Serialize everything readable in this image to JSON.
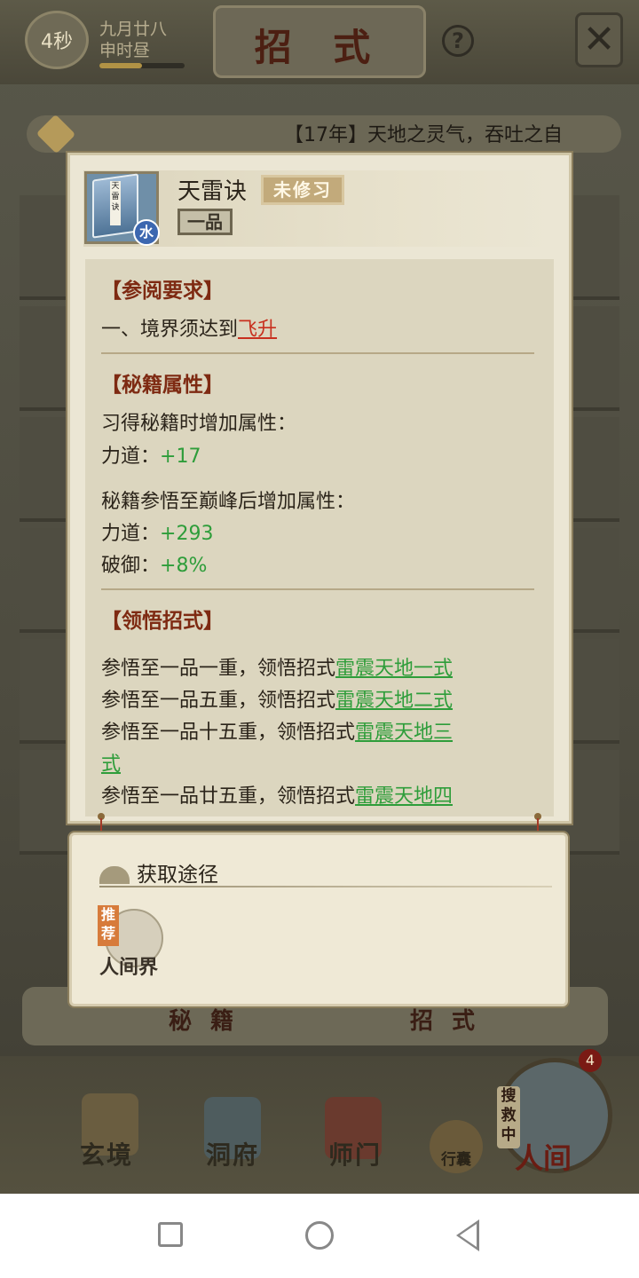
{
  "header": {
    "timer": "4秒",
    "date_line1": "九月廿八",
    "date_line2": "申时昼",
    "title": "招 式",
    "help": "?",
    "close": "✕"
  },
  "marquee": {
    "text": "【17年】天地之灵气，吞吐之自"
  },
  "popup": {
    "skill_name": "天雷诀",
    "status": "未修习",
    "grade": "一品",
    "element": "水",
    "book_label": "天雷诀",
    "sections": {
      "requirement_title": "【参阅要求】",
      "requirement_prefix": "一、境界须达到",
      "requirement_realm": "飞升",
      "attributes_title": "【秘籍属性】",
      "learn_gain_label": "习得秘籍时增加属性：",
      "learn_gain_stat": "力道：",
      "learn_gain_value": "+17",
      "peak_gain_label": "秘籍参悟至巅峰后增加属性：",
      "peak_stat1": "力道：",
      "peak_value1": "+293",
      "peak_stat2": "破御：",
      "peak_value2": "+8%",
      "moves_title": "【领悟招式】",
      "moves": [
        {
          "prefix": "参悟至一品一重，领悟招式",
          "move": "雷震天地一式"
        },
        {
          "prefix": "参悟至一品五重，领悟招式",
          "move": "雷震天地二式"
        },
        {
          "prefix": "参悟至一品十五重，领悟招式",
          "move": "雷震天地三"
        },
        {
          "prefix": "",
          "move": "式"
        },
        {
          "prefix": "参悟至一品廿五重，领悟招式",
          "move": "雷震天地四"
        }
      ]
    }
  },
  "source": {
    "title": "获取途径",
    "recommend": "推荐",
    "realm": "人间界"
  },
  "tabs": {
    "miji": "秘 籍",
    "zhaoshi": "招 式"
  },
  "nav": {
    "xuanjing": "玄境",
    "dongfu": "洞府",
    "shimen": "师门",
    "xingnang": "行囊",
    "renjian": "人间",
    "soujiu": "搜救中",
    "badge": "4"
  }
}
